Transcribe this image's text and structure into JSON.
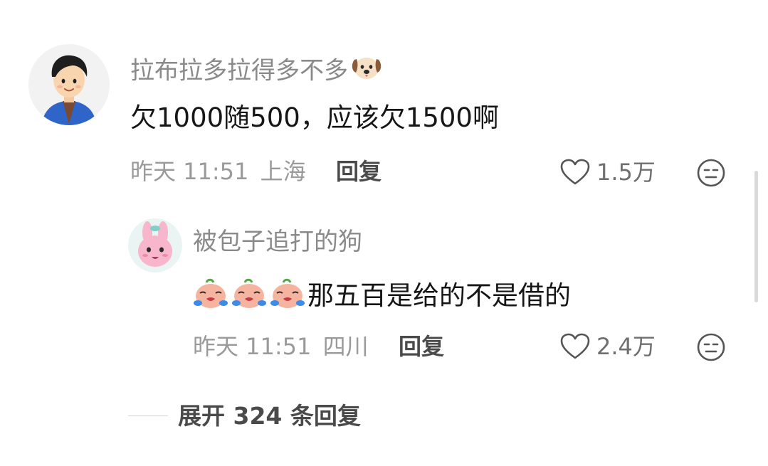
{
  "comment": {
    "author": "拉布拉多拉得多不多",
    "author_emoji": "dog-face",
    "text": "欠1000随500，应该欠1500啊",
    "time": "昨天 11:51",
    "location": "上海",
    "reply_label": "回复",
    "likes": "1.5万"
  },
  "reply": {
    "author": "被包子追打的狗",
    "emoji_prefix": [
      "crying-bun",
      "crying-bun",
      "crying-bun"
    ],
    "text": "那五百是给的不是借的",
    "time": "昨天 11:51",
    "location": "四川",
    "reply_label": "回复",
    "likes": "2.4万"
  },
  "expand_replies": {
    "label": "展开 324 条回复"
  },
  "colors": {
    "name": "#8a8a8a",
    "body_text": "#161616",
    "meta": "#9a9a9a",
    "accent_bun": "#f2a48e"
  }
}
